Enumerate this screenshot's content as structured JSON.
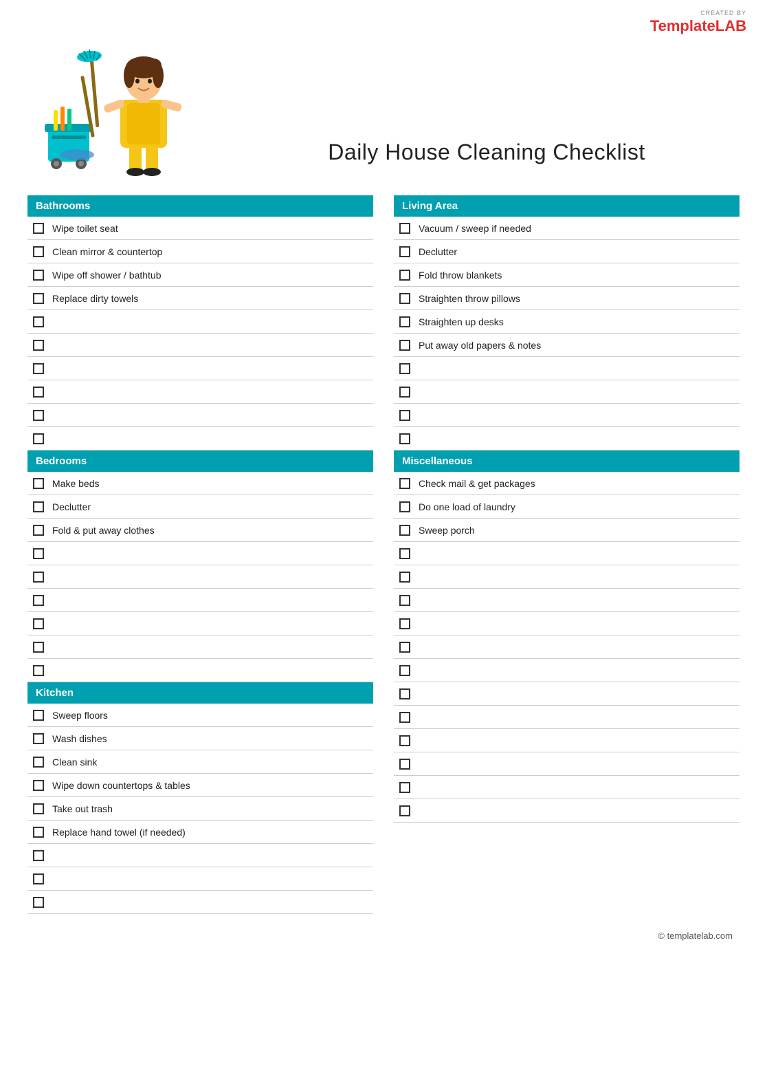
{
  "logo": {
    "created_by": "CREATED BY",
    "template": "Template",
    "lab": "LAB"
  },
  "title": "Daily House Cleaning Checklist",
  "sections": {
    "left": [
      {
        "id": "bathrooms",
        "header": "Bathrooms",
        "items": [
          "Wipe toilet seat",
          "Clean mirror & countertop",
          "Wipe off shower / bathtub",
          "Replace dirty towels",
          "",
          "",
          "",
          "",
          "",
          ""
        ]
      },
      {
        "id": "bedrooms",
        "header": "Bedrooms",
        "items": [
          "Make beds",
          "Declutter",
          "Fold & put away clothes",
          "",
          "",
          "",
          "",
          "",
          ""
        ]
      },
      {
        "id": "kitchen",
        "header": "Kitchen",
        "items": [
          "Sweep floors",
          "Wash dishes",
          "Clean sink",
          "Wipe down countertops & tables",
          "Take out trash",
          "Replace hand towel (if needed)",
          "",
          "",
          ""
        ]
      }
    ],
    "right": [
      {
        "id": "living-area",
        "header": "Living Area",
        "items": [
          "Vacuum / sweep if needed",
          "Declutter",
          "Fold throw blankets",
          "Straighten throw pillows",
          "Straighten up desks",
          "Put away old papers & notes",
          "",
          "",
          "",
          ""
        ]
      },
      {
        "id": "miscellaneous",
        "header": "Miscellaneous",
        "items": [
          "Check mail & get packages",
          "Do one load of laundry",
          "Sweep porch",
          "",
          "",
          "",
          "",
          "",
          "",
          "",
          "",
          "",
          "",
          "",
          ""
        ]
      }
    ]
  },
  "footer": "© templatelab.com"
}
